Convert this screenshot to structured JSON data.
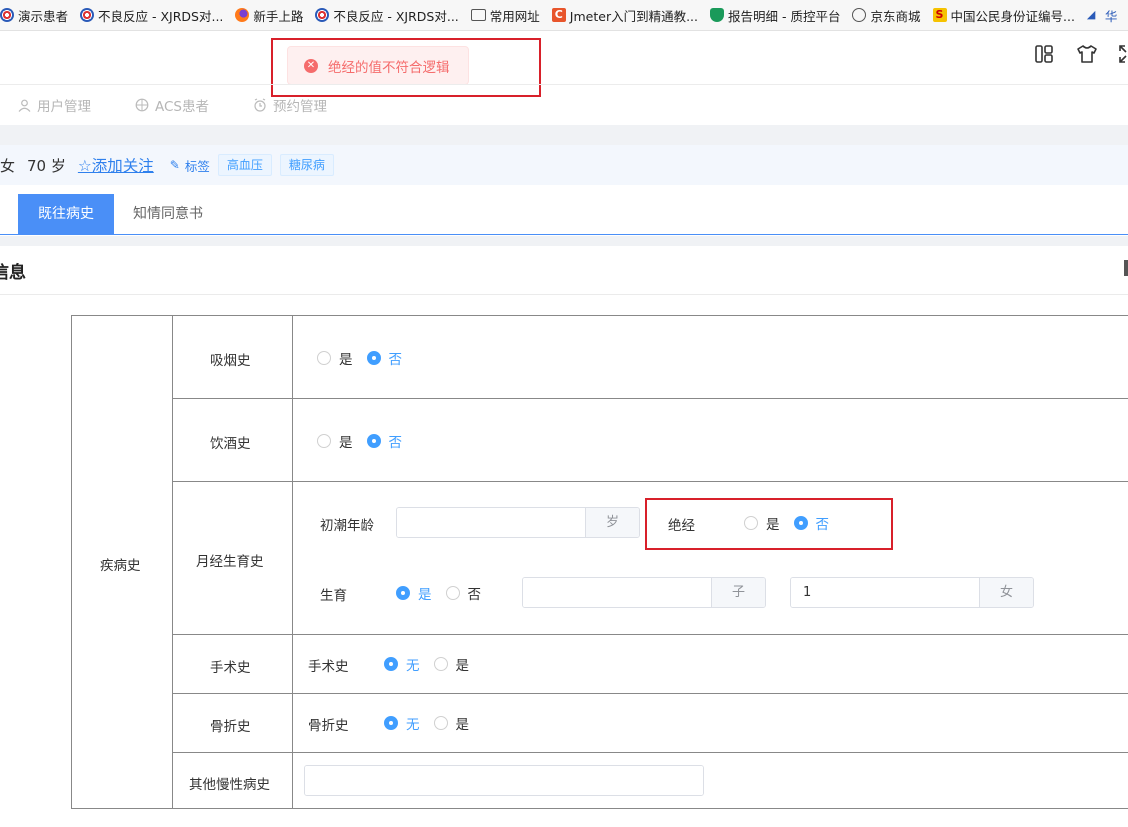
{
  "bookmarks": [
    {
      "label": "演示患者",
      "icon": "target-icon"
    },
    {
      "label": "不良反应 - XJRDS对...",
      "icon": "target-icon"
    },
    {
      "label": "新手上路",
      "icon": "firefox-icon"
    },
    {
      "label": "不良反应 - XJRDS对...",
      "icon": "target-icon"
    },
    {
      "label": "常用网址",
      "icon": "folder-icon"
    },
    {
      "label": "Jmeter入门到精通教...",
      "icon": "c-icon"
    },
    {
      "label": "报告明细 - 质控平台",
      "icon": "shield-icon"
    },
    {
      "label": "京东商城",
      "icon": "globe-icon"
    },
    {
      "label": "中国公民身份证编号...",
      "icon": "s-icon"
    },
    {
      "label": "华",
      "icon": "logo-icon"
    }
  ],
  "toast": {
    "message": "绝经的值不符合逻辑",
    "type": "error"
  },
  "nav": [
    {
      "label": "用户管理",
      "icon": "user-icon"
    },
    {
      "label": "ACS患者",
      "icon": "target-icon"
    },
    {
      "label": "预约管理",
      "icon": "alarm-icon"
    }
  ],
  "patient": {
    "gender": "女",
    "age": "70 岁",
    "follow": "☆添加关注",
    "tag_label": "标签",
    "tags": [
      "高血压",
      "糖尿病"
    ]
  },
  "tabs": {
    "active": "既往病史",
    "inactive": "知情同意书"
  },
  "section": {
    "title": "信息"
  },
  "table": {
    "group": "疾病史",
    "smoking": {
      "label": "吸烟史",
      "yes": "是",
      "no": "否",
      "selected": "否"
    },
    "drinking": {
      "label": "饮酒史",
      "yes": "是",
      "no": "否",
      "selected": "否"
    },
    "menstrual": {
      "label": "月经生育史",
      "menarche_label": "初潮年龄",
      "menarche_value": "",
      "menarche_suffix": "岁",
      "menopause_label": "绝经",
      "menopause_yes": "是",
      "menopause_no": "否",
      "menopause_selected": "否",
      "birth_label": "生育",
      "birth_yes": "是",
      "birth_no": "否",
      "birth_selected": "是",
      "sons_value": "",
      "sons_suffix": "子",
      "daughters_value": "1",
      "daughters_suffix": "女"
    },
    "surgery": {
      "label": "手术史",
      "inner_label": "手术史",
      "none": "无",
      "yes": "是",
      "selected": "无"
    },
    "fracture": {
      "label": "骨折史",
      "inner_label": "骨折史",
      "none": "无",
      "yes": "是",
      "selected": "无"
    },
    "chronic": {
      "label": "其他慢性病史",
      "value": ""
    }
  }
}
